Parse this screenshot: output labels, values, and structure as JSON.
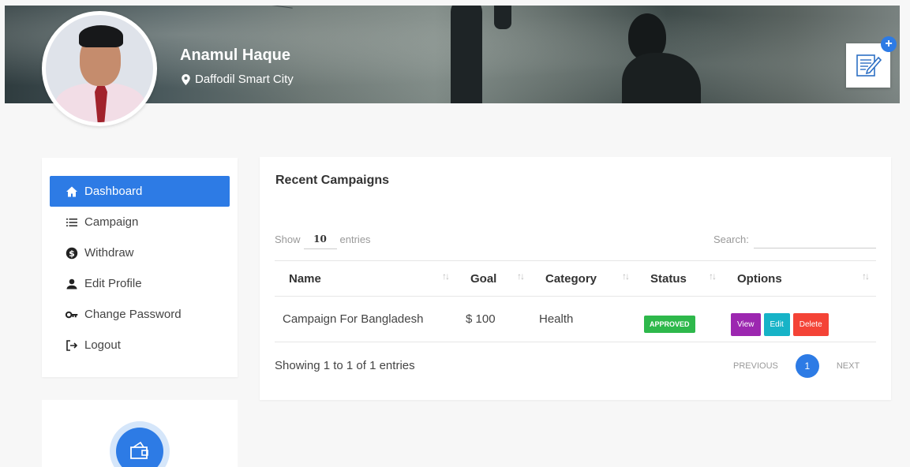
{
  "profile": {
    "name": "Anamul Haque",
    "location": "Daffodil Smart City"
  },
  "header": {
    "add_icon": "plus-icon",
    "edit_icon": "pencil-document-icon"
  },
  "sidebar": {
    "items": [
      {
        "label": "Dashboard",
        "icon": "home-icon",
        "active": true
      },
      {
        "label": "Campaign",
        "icon": "list-icon",
        "active": false
      },
      {
        "label": "Withdraw",
        "icon": "dollar-circle-icon",
        "active": false
      },
      {
        "label": "Edit Profile",
        "icon": "user-icon",
        "active": false
      },
      {
        "label": "Change Password",
        "icon": "key-icon",
        "active": false
      },
      {
        "label": "Logout",
        "icon": "logout-icon",
        "active": false
      }
    ]
  },
  "campaigns": {
    "title": "Recent Campaigns",
    "show_label": "Show",
    "entries_value": "10",
    "entries_label": "entries",
    "search_label": "Search:",
    "columns": [
      "Name",
      "Goal",
      "Category",
      "Status",
      "Options"
    ],
    "rows": [
      {
        "name": "Campaign For Bangladesh",
        "goal": "$ 100",
        "category": "Health",
        "status": "APPROVED",
        "options": [
          "View",
          "Edit",
          "Delete"
        ]
      }
    ],
    "info": "Showing 1 to 1 of 1 entries",
    "pagination": {
      "previous": "PREVIOUS",
      "current": "1",
      "next": "NEXT"
    }
  },
  "colors": {
    "primary": "#2d7be5",
    "approved": "#2eb84b",
    "view": "#9c27b0",
    "edit": "#17b3c7",
    "delete": "#f44336"
  }
}
